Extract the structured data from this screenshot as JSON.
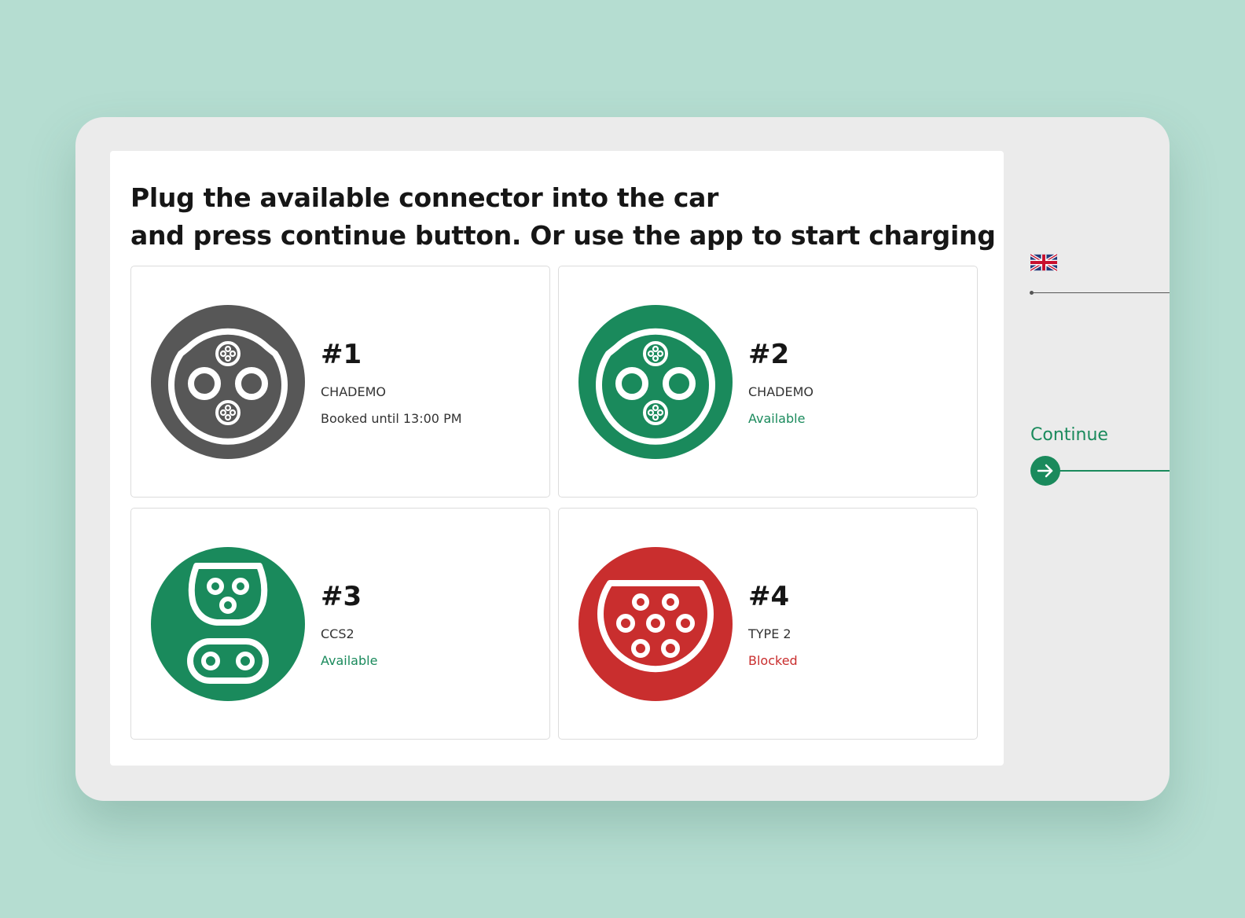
{
  "colors": {
    "background": "#b5ddd1",
    "frame": "#ebebeb",
    "accent_green": "#1a8a5c",
    "booked_gray": "#575757",
    "blocked_red": "#c92e2e"
  },
  "header": {
    "title_line1": "Plug the available connector into the car",
    "title_line2": "and press continue button. Or use the app to start charging"
  },
  "connectors": [
    {
      "number": "#1",
      "type": "CHADEMO",
      "status": "Booked until 13:00 PM",
      "status_color": "#333333",
      "icon": "chademo-connector-icon",
      "icon_color": "#575757"
    },
    {
      "number": "#2",
      "type": "CHADEMO",
      "status": "Available",
      "status_color": "#1a8a5c",
      "icon": "chademo-connector-icon",
      "icon_color": "#1a8a5c"
    },
    {
      "number": "#3",
      "type": "CCS2",
      "status": "Available",
      "status_color": "#1a8a5c",
      "icon": "ccs2-connector-icon",
      "icon_color": "#1a8a5c"
    },
    {
      "number": "#4",
      "type": "TYPE 2",
      "status": "Blocked",
      "status_color": "#c92e2e",
      "icon": "type2-connector-icon",
      "icon_color": "#c92e2e"
    }
  ],
  "sidebar": {
    "language_icon": "uk-flag-icon",
    "continue_label": "Continue",
    "continue_icon": "arrow-right-icon"
  }
}
